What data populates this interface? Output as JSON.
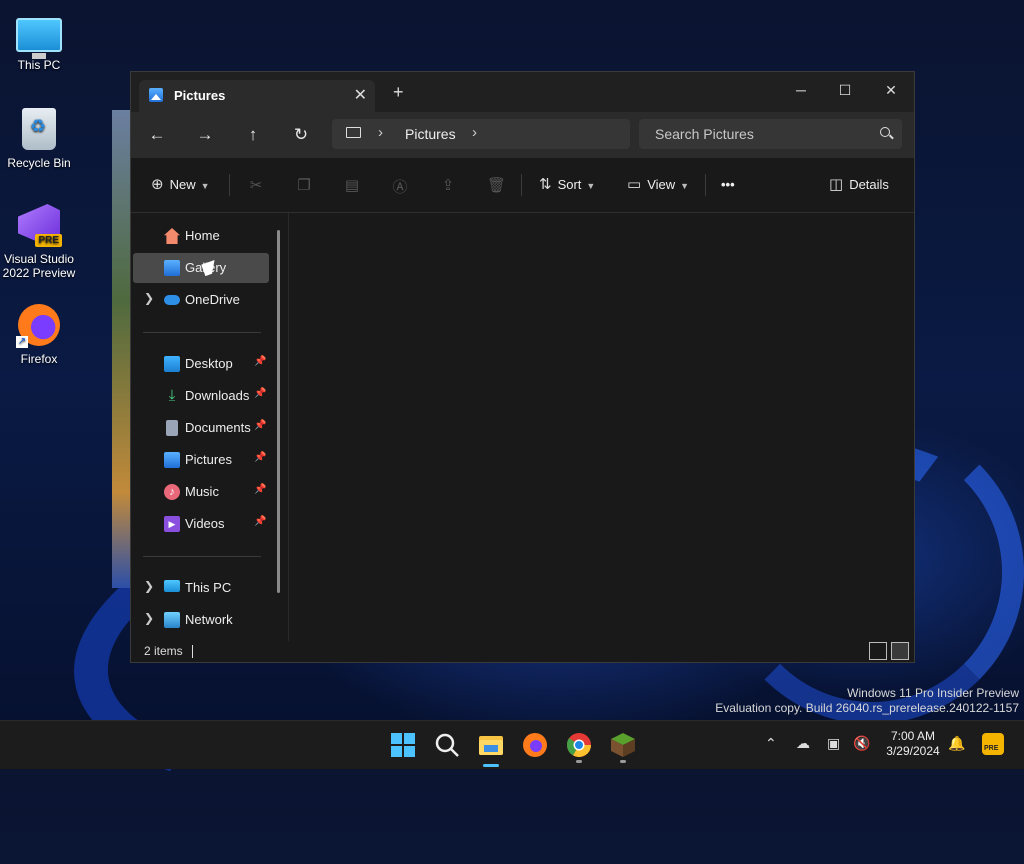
{
  "desktop": {
    "icons": [
      {
        "label": "This PC"
      },
      {
        "label": "Recycle Bin"
      },
      {
        "label": "Visual Studio\n2022 Preview",
        "line1": "Visual Studio",
        "line2": "2022 Preview",
        "badge": "PRE"
      },
      {
        "label": "Firefox"
      }
    ]
  },
  "window": {
    "tab_title": "Pictures",
    "tab_close": "✕",
    "tab_add": "+",
    "controls": {
      "minimize": "─",
      "maximize": "☐",
      "close": "✕"
    },
    "address": {
      "segments": [
        "Pictures"
      ]
    },
    "search_placeholder": "Search Pictures",
    "commands": {
      "new": "New",
      "sort": "Sort",
      "view": "View",
      "more": "•••",
      "details": "Details"
    },
    "sidebar": {
      "top": [
        {
          "label": "Home"
        },
        {
          "label": "Gallery"
        },
        {
          "label": "OneDrive"
        }
      ],
      "pinned": [
        {
          "label": "Desktop"
        },
        {
          "label": "Downloads"
        },
        {
          "label": "Documents"
        },
        {
          "label": "Pictures"
        },
        {
          "label": "Music"
        },
        {
          "label": "Videos"
        }
      ],
      "bottom": [
        {
          "label": "This PC"
        },
        {
          "label": "Network"
        }
      ]
    },
    "status": {
      "items": "2 items"
    }
  },
  "watermark": {
    "line1": "Windows 11 Pro Insider Preview",
    "line2": "Evaluation copy. Build 26040.rs_prerelease.240122-1157"
  },
  "taskbar": {
    "clock_time": "7:00 AM",
    "clock_date": "3/29/2024",
    "tray_badge": "PRE"
  },
  "colors": {
    "accent": "#4cc2ff",
    "window_bg": "#191919",
    "toolbar_bg": "#2b2b2b",
    "selected_item": "#4a4a4a"
  }
}
